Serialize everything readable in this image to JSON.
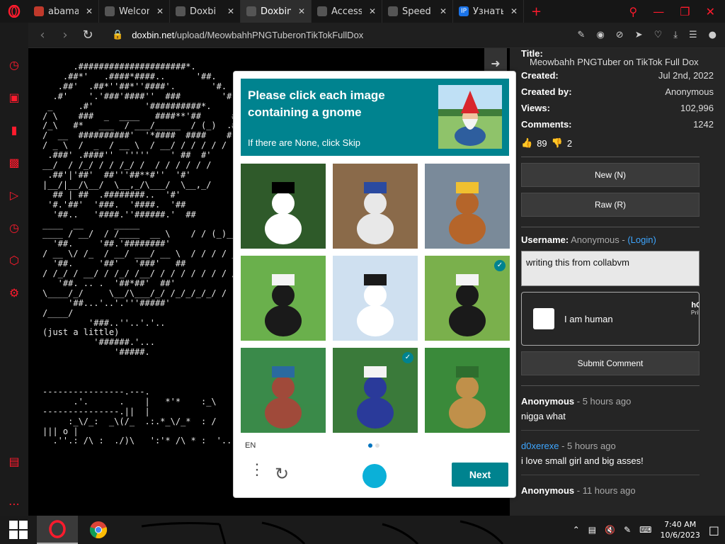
{
  "tabs": [
    {
      "label": "abama D",
      "favicon_color": "#c0392b",
      "favicon": "gamepad-icon"
    },
    {
      "label": "Welcome",
      "favicon_color": "#555555",
      "favicon": "globe-icon"
    },
    {
      "label": "Doxbi",
      "favicon_color": "#555555",
      "favicon": "globe-icon"
    },
    {
      "label": "Doxbin -",
      "favicon_color": "#555555",
      "favicon": "globe-icon",
      "active": true
    },
    {
      "label": "Access D",
      "favicon_color": "#555555",
      "favicon": "access-icon"
    },
    {
      "label": "Speed D",
      "favicon_color": "#555555",
      "favicon": "grid-icon"
    },
    {
      "label": "Узнать IP",
      "favicon_color": "#1a73e8",
      "favicon": "ip-icon",
      "favicon_text": "IP"
    }
  ],
  "address": {
    "domain": "doxbin.net",
    "path": "/upload/MeowbahhPNGTuberonTikTokFullDox"
  },
  "paste": {
    "title_label": "Title:",
    "title_value": "Meowbahh PNGTuber on TikTok Full Dox",
    "created_label": "Created:",
    "created_value": "Jul 2nd, 2022",
    "created_by_label": "Created by:",
    "created_by_value": "Anonymous",
    "views_label": "Views:",
    "views_value": "102,996",
    "comments_label": "Comments:",
    "comments_value": "1242",
    "likes": "89",
    "dislikes": "2",
    "new_button": "New (N)",
    "raw_button": "Raw (R)"
  },
  "comment_form": {
    "username_label": "Username:",
    "username_value": "Anonymous -",
    "login_link": "(Login)",
    "comment_text": "writing this from collabvm",
    "captcha_label": "I am human",
    "captcha_brand": "hC",
    "captcha_brand_sub": "Priv",
    "submit_button": "Submit Comment"
  },
  "comments": [
    {
      "name": "Anonymous",
      "time": "- 5 hours ago",
      "text": "nigga what",
      "blue": false
    },
    {
      "name": "d0xerexe",
      "time": "- 5 hours ago",
      "text": "i love small girl and big asses!",
      "blue": true
    },
    {
      "name": "Anonymous",
      "time": "- 11 hours ago",
      "text": "",
      "blue": false
    }
  ],
  "ascii_art": "      .#####################*.\n    .##*'   .####*####..      '##.\n   .##'  .##*''##*''####'.       '#.\n  .#'    '.'###'####''  ###        '#\n _     .#'          '##########*.    '\n/ \\    ###  _  ____   ####**'##      #\n/_\\   #*   ___  / ___/_____  / (_)  .#\n/  __  ##########'  '*####  ####    #\n/ _ \\  /  _  / __ \\  / __/ / / / / /\n .###' .####''  '''''    ' ##  #'\n__/  / /_/ / / /_/ /  / / / / / /\n .##'|'##'  ##'''##**#''  '#'\n|__/|__/\\__/  \\__,_/\\___/  \\__,_/\n  ## | ##  .########..  '#'\n '#.'##'  '###.  '####.  '##\n  '##..   '####.''######.'  ##\n____  __      _____\n____ / __/  / /____  __ \\    / / (_)___\n  '##.     '##.'########'\n/ __ \\/ /_  / __/ ___/ __ \\  / / / / __\n  '##.     '##'   '###'   ##\n/ /_/ / __/ / /_/ /__/ / / / / / / / /\n   '##. .. .  '##*##'  ##'\n\\____/_/     \\__/\\___/_/ /_/_/_/_/ /\n     '##...'..'.'''#####'\n/____/\n         '###..''..'.'..\n(just a little)\n          '######.'...\n              '#####.\n\n\n\n----------------.---.\n      .'.      .    |   *'*    :_\\\n---------------.||  |\n     :_\\/_:  _\\(/_  .:.*_\\/_*  : /\n||| o |\n  .''.: /\\ :  ./)\\   ':'* /\\ * :  '..'.  -=:o:=-   | _ |||     The Tale of Jenna Leigh",
  "hcaptcha": {
    "prompt": "Please click each image containing a gnome",
    "subtext": "If there are None, click Skip",
    "language": "EN",
    "next_button": "Next",
    "cells": [
      {
        "subject": "snowman in forest",
        "selected": false
      },
      {
        "subject": "robot on tracks",
        "selected": false
      },
      {
        "subject": "rusty robot with lamp",
        "selected": false
      },
      {
        "subject": "gnome with top hat",
        "selected": false
      },
      {
        "subject": "snowman in snow",
        "selected": false
      },
      {
        "subject": "gnome with top hat on grass",
        "selected": true
      },
      {
        "subject": "rusty robot in garden",
        "selected": false
      },
      {
        "subject": "gnome with wizard hat",
        "selected": true
      },
      {
        "subject": "cat in garden",
        "selected": false
      }
    ]
  },
  "taskbar": {
    "time": "7:40 AM",
    "date": "10/6/2023"
  },
  "colors": {
    "opera_red": "#ff1b2d",
    "hcaptcha_teal": "#00838f",
    "link_blue": "#3ea6ff"
  }
}
